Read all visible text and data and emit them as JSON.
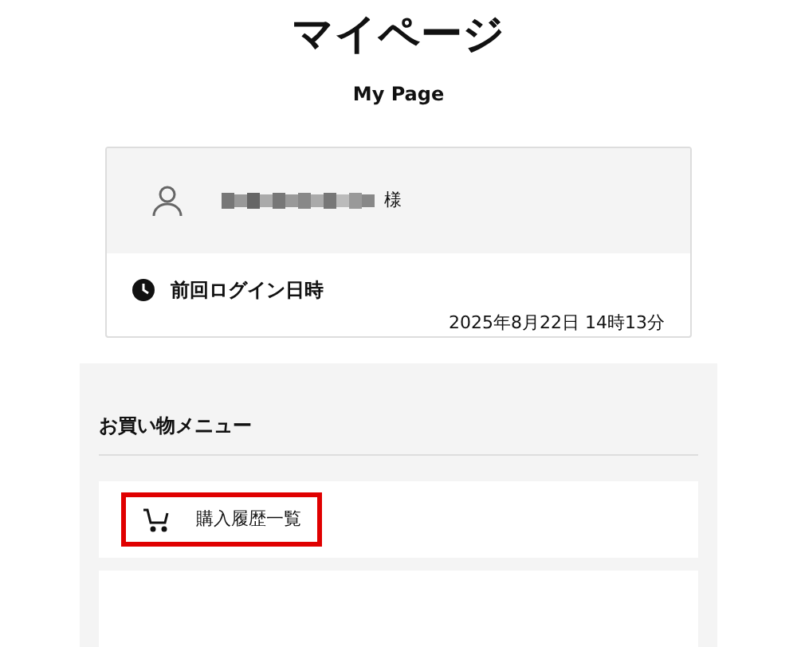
{
  "page": {
    "title": "マイページ",
    "subtitle": "My Page"
  },
  "profile": {
    "honorific": "様",
    "last_login_label": "前回ログイン日時",
    "last_login_value": "2025年8月22日 14時13分"
  },
  "shopping_menu": {
    "heading": "お買い物メニュー",
    "items": [
      {
        "kind": "link",
        "label": "購入履歴一覧",
        "highlighted": true
      },
      {
        "kind": "cut"
      }
    ]
  }
}
